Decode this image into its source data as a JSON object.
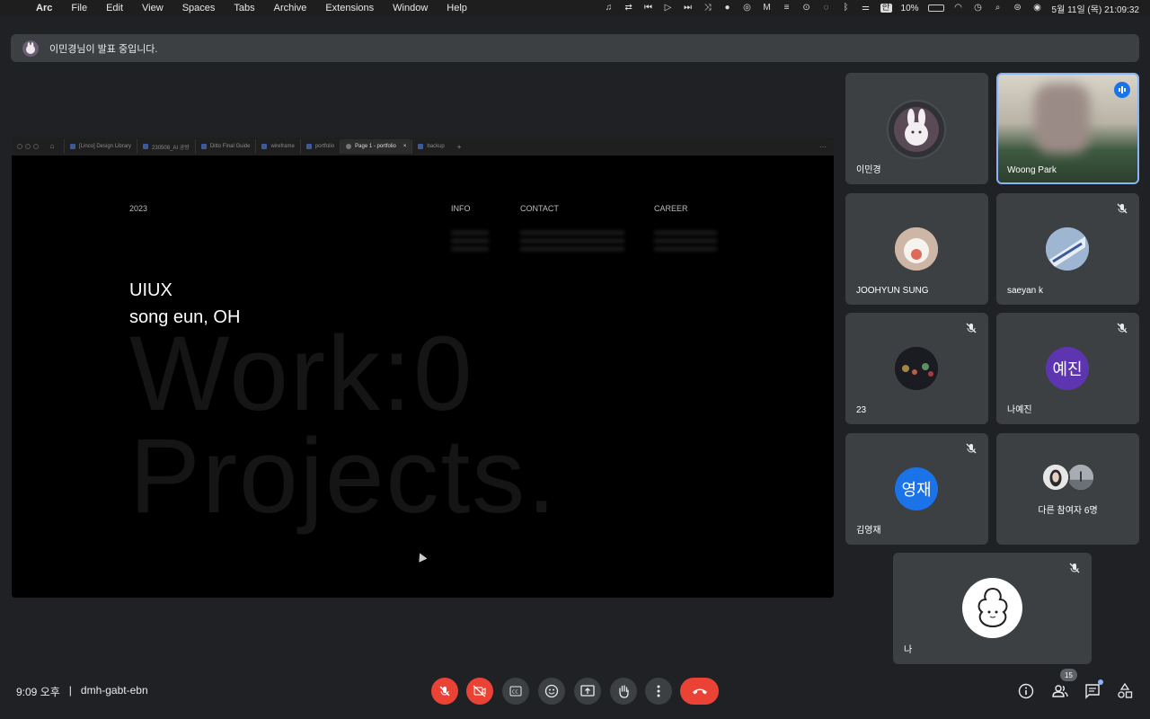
{
  "menubar": {
    "app": "Arc",
    "items": [
      "File",
      "Edit",
      "View",
      "Spaces",
      "Tabs",
      "Archive",
      "Extensions",
      "Window",
      "Help"
    ],
    "battery": "10%",
    "ime": "한",
    "datetime": "5월 11일 (목) 21:09:32"
  },
  "banner": {
    "text": "이민경님이 발표 중입니다."
  },
  "browser_tabs": [
    {
      "label": "[Linco] Design Library"
    },
    {
      "label": "230508_AI 공방"
    },
    {
      "label": "Ditto Final Guide"
    },
    {
      "label": "wireframe"
    },
    {
      "label": "portfolio"
    },
    {
      "label": "Page 1 - portfolio",
      "active": true
    },
    {
      "label": "backup"
    }
  ],
  "slide": {
    "year": "2023",
    "nav": [
      "INFO",
      "CONTACT",
      "CAREER"
    ],
    "title_line1": "UIUX",
    "title_line2": "song eun, OH",
    "big_line1": "Work:0",
    "big_line2": "Projects."
  },
  "participants": [
    {
      "name": "이민경",
      "muted": false
    },
    {
      "name": "Woong Park",
      "speaking": true
    },
    {
      "name": "JOOHYUN SUNG",
      "muted": true
    },
    {
      "name": "saeyan k",
      "muted": true
    },
    {
      "name": "23",
      "muted": true
    },
    {
      "name": "나예진",
      "initials": "예진",
      "muted": true,
      "color": "#5e35b1"
    },
    {
      "name": "김영재",
      "initials": "영재",
      "muted": true,
      "color": "#1a73e8"
    },
    {
      "name": "다른 참여자 6명"
    },
    {
      "name": "나",
      "muted": true
    }
  ],
  "meeting": {
    "time": "9:09 오후",
    "separator": "|",
    "code": "dmh-gabt-ebn",
    "people_count": "15"
  }
}
